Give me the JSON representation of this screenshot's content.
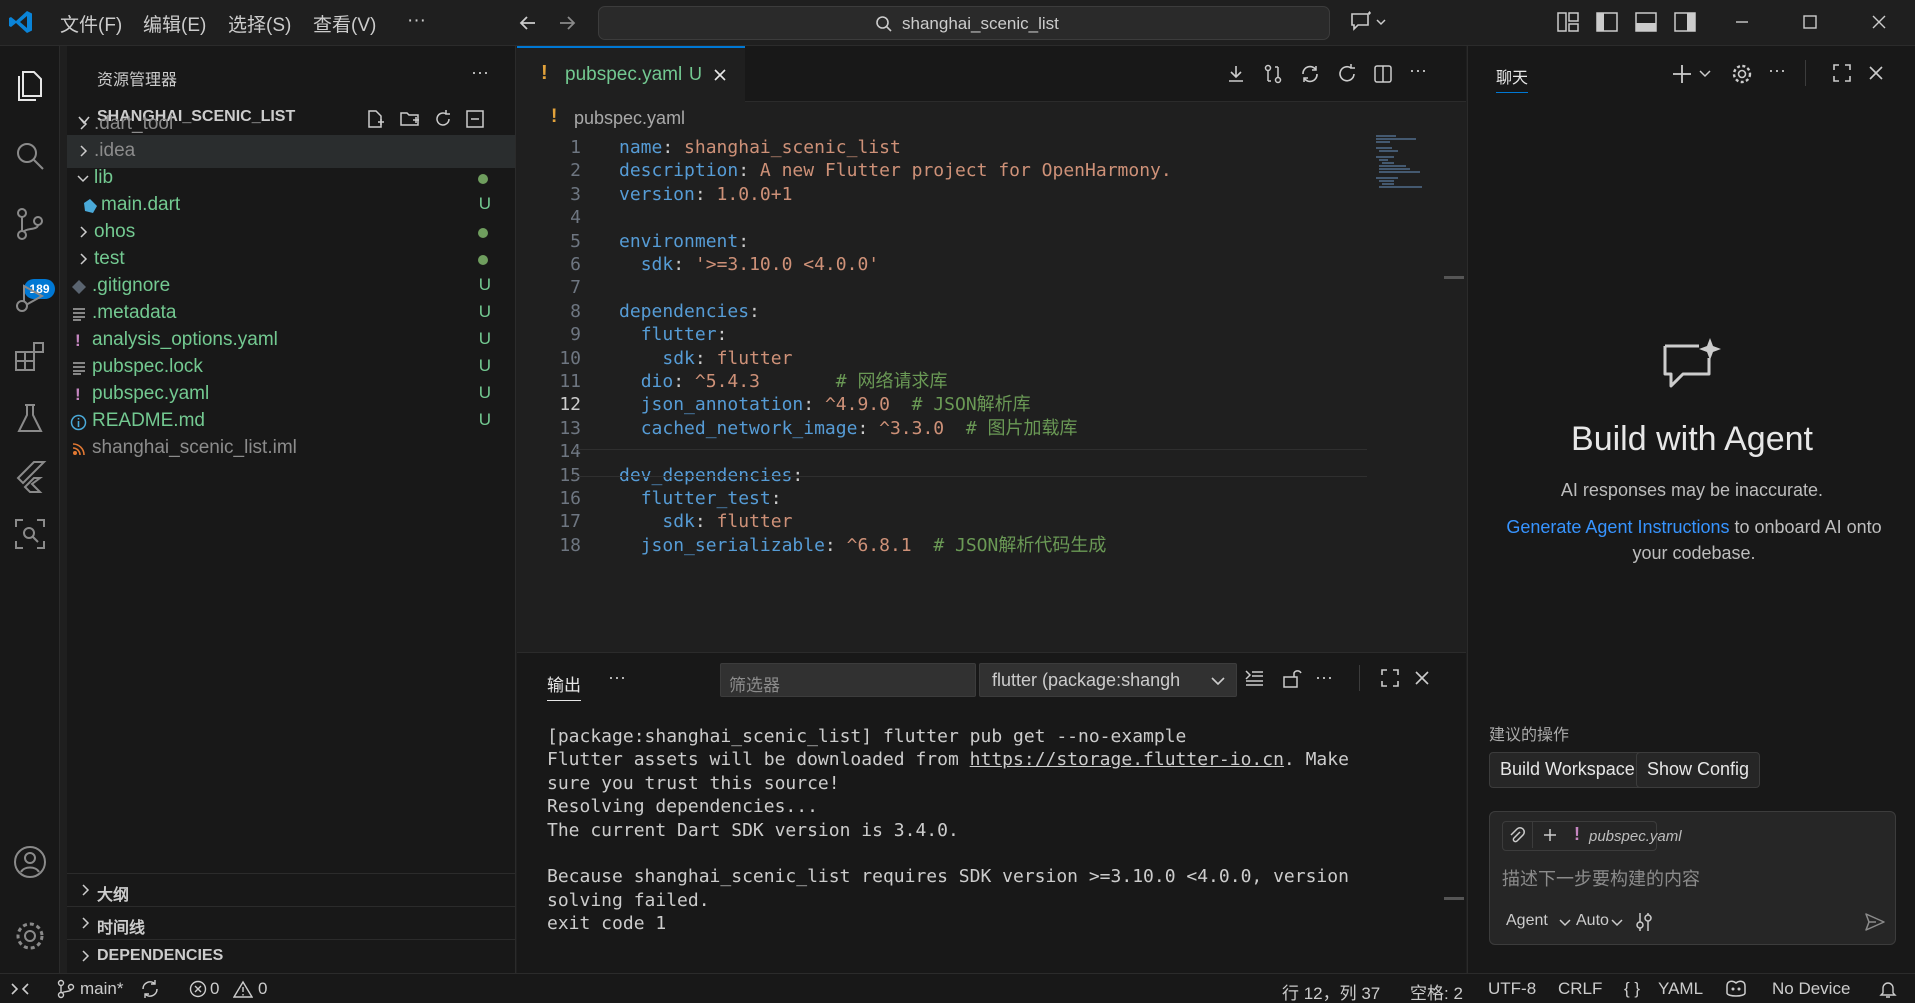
{
  "menu": {
    "file": "文件(F)",
    "edit": "编辑(E)",
    "selection": "选择(S)",
    "view": "查看(V)",
    "more": "···"
  },
  "search": {
    "text": "shanghai_scenic_list"
  },
  "activity": {
    "scm_badge": "189"
  },
  "explorer": {
    "title": "资源管理器",
    "folder": "SHANGHAI_SCENIC_LIST",
    "items": [
      {
        "label": ".dart_tool",
        "badge": ""
      },
      {
        "label": ".idea",
        "badge": ""
      },
      {
        "label": "lib",
        "badge": ""
      },
      {
        "label": "main.dart",
        "badge": "U"
      },
      {
        "label": "ohos",
        "badge": ""
      },
      {
        "label": "test",
        "badge": ""
      },
      {
        "label": ".gitignore",
        "badge": "U"
      },
      {
        "label": ".metadata",
        "badge": "U"
      },
      {
        "label": "analysis_options.yaml",
        "badge": "U"
      },
      {
        "label": "pubspec.lock",
        "badge": "U"
      },
      {
        "label": "pubspec.yaml",
        "badge": "U"
      },
      {
        "label": "README.md",
        "badge": "U"
      },
      {
        "label": "shanghai_scenic_list.iml",
        "badge": ""
      }
    ],
    "sections": {
      "outline": "大纲",
      "timeline": "时间线",
      "dependencies": "DEPENDENCIES"
    }
  },
  "editor": {
    "tab": {
      "name": "pubspec.yaml",
      "status": "U",
      "icon": "!"
    },
    "breadcrumb": "pubspec.yaml",
    "lines": [
      {
        "n": "1",
        "text": "name: shanghai_scenic_list"
      },
      {
        "n": "2",
        "text": "description: A new Flutter project for OpenHarmony."
      },
      {
        "n": "3",
        "text": "version: 1.0.0+1"
      },
      {
        "n": "4",
        "text": ""
      },
      {
        "n": "5",
        "text": "environment:"
      },
      {
        "n": "6",
        "text": "  sdk: '>=3.10.0 <4.0.0'"
      },
      {
        "n": "7",
        "text": ""
      },
      {
        "n": "8",
        "text": "dependencies:"
      },
      {
        "n": "9",
        "text": "  flutter:"
      },
      {
        "n": "10",
        "text": "    sdk: flutter"
      },
      {
        "n": "11",
        "text": "  dio: ^5.4.3       # 网络请求库"
      },
      {
        "n": "12",
        "text": "  json_annotation: ^4.9.0  # JSON解析库"
      },
      {
        "n": "13",
        "text": "  cached_network_image: ^3.3.0  # 图片加载库"
      },
      {
        "n": "14",
        "text": ""
      },
      {
        "n": "15",
        "text": "dev_dependencies:"
      },
      {
        "n": "16",
        "text": "  flutter_test:"
      },
      {
        "n": "17",
        "text": "    sdk: flutter"
      },
      {
        "n": "18",
        "text": "  json_serializable: ^6.8.1  # JSON解析代码生成"
      }
    ]
  },
  "panel": {
    "tab": "输出",
    "filter_placeholder": "筛选器",
    "channel": "flutter (package:shangh",
    "output": [
      "[package:shanghai_scenic_list] flutter pub get --no-example",
      "Flutter assets will be downloaded from ",
      "https://storage.flutter-io.cn",
      ". Make",
      "sure you trust this source!",
      "Resolving dependencies...",
      "The current Dart SDK version is 3.4.0.",
      "",
      "Because shanghai_scenic_list requires SDK version >=3.10.0 <4.0.0, version",
      "solving failed.",
      "exit code 1"
    ]
  },
  "chat": {
    "tab": "聊天",
    "title": "Build with Agent",
    "subtitle": "AI responses may be inaccurate.",
    "link": "Generate Agent Instructions",
    "desc_rest": " to onboard AI onto your codebase.",
    "suggest_label": "建议的操作",
    "suggest_buttons": [
      "Build Workspace",
      "Show Config"
    ],
    "context_file": "pubspec.yaml",
    "input_placeholder": "描述下一步要构建的内容",
    "mode": "Agent",
    "model": "Auto"
  },
  "status": {
    "branch": "main*",
    "errors": "0",
    "warnings": "0",
    "position": "行 12，列 37",
    "spaces": "空格: 2",
    "encoding": "UTF-8",
    "eol": "CRLF",
    "language": "YAML",
    "device": "No Device"
  },
  "colors": {
    "accent": "#0078d4",
    "untracked": "#73c991",
    "yaml_key": "#569cd6",
    "yaml_value": "#ce9178",
    "comment": "#6a9955"
  }
}
